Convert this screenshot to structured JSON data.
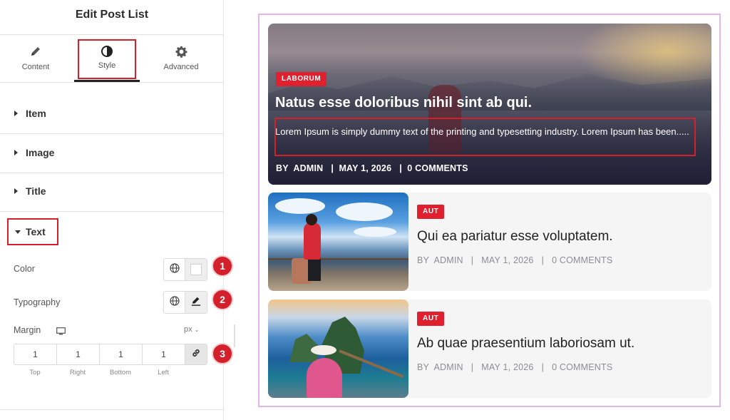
{
  "panel": {
    "title": "Edit Post List",
    "tabs": [
      {
        "label": "Content",
        "icon": "pencil-icon"
      },
      {
        "label": "Style",
        "icon": "half-circle-icon"
      },
      {
        "label": "Advanced",
        "icon": "gear-icon"
      }
    ],
    "sections": [
      {
        "label": "Item"
      },
      {
        "label": "Image"
      },
      {
        "label": "Title"
      },
      {
        "label": "Text"
      }
    ],
    "color_label": "Color",
    "typography_label": "Typography",
    "margin_label": "Margin",
    "margin_unit": "px",
    "margin": {
      "values": [
        "1",
        "1",
        "1",
        "1"
      ],
      "labels": [
        "Top",
        "Right",
        "Bottom",
        "Left"
      ]
    },
    "badges": [
      "1",
      "2",
      "3"
    ]
  },
  "preview": {
    "hero": {
      "tag": "LABORUM",
      "title": "Natus esse doloribus nihil sint ab qui.",
      "text": "Lorem Ipsum is simply dummy text of the printing and typesetting industry. Lorem Ipsum has been.....",
      "meta": "BY  ADMIN   |  MAY 1, 2026   |  0 COMMENTS"
    },
    "cards": [
      {
        "tag": "AUT",
        "title": "Qui ea pariatur esse voluptatem.",
        "meta": "BY  ADMIN   |   MAY 1, 2026   |   0 COMMENTS"
      },
      {
        "tag": "AUT",
        "title": "Ab quae praesentium laboriosam ut.",
        "meta": "BY  ADMIN   |   MAY 1, 2026   |   0 COMMENTS"
      }
    ]
  },
  "colors": {
    "accent_red": "#d3202a",
    "tag_red": "#e0202e",
    "preview_border": "#e4b4ec"
  }
}
